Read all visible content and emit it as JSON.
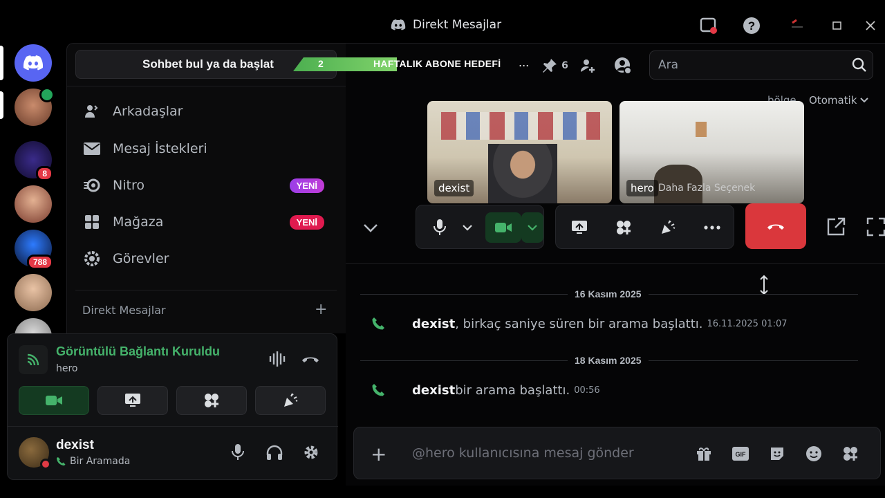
{
  "window": {
    "title": "Direkt Mesajlar"
  },
  "servers": [
    {
      "name": "Discord Home"
    },
    {
      "name": "Server 2"
    },
    {
      "name": "Server 3",
      "badge": "8"
    },
    {
      "name": "Server 4"
    },
    {
      "name": "Server 5",
      "badge": "788"
    },
    {
      "name": "Server 6"
    }
  ],
  "sidebar": {
    "find_label": "Sohbet bul ya da başlat",
    "items": [
      {
        "label": "Arkadaşlar"
      },
      {
        "label": "Mesaj İstekleri"
      },
      {
        "label": "Nitro",
        "badge": "YENİ"
      },
      {
        "label": "Mağaza",
        "badge": "YENİ"
      },
      {
        "label": "Görevler"
      }
    ],
    "dm_header": "Direkt Mesajlar"
  },
  "voice": {
    "status": "Görüntülü Bağlantı Kuruldu",
    "channel": "hero"
  },
  "user": {
    "name": "dexist",
    "status": "Bir Aramada"
  },
  "overlay": {
    "goal_value": "2",
    "goal_label": "HAFTALIK ABONE HEDEFİ",
    "goal_dots": "..."
  },
  "header": {
    "pinned_count": "6",
    "search_placeholder": "Ara",
    "region_label": "bölge",
    "region_value": "Otomatik"
  },
  "video": {
    "tiles": [
      {
        "name": "dexist"
      },
      {
        "name": "hero",
        "hint": "Daha Fazla Seçenek"
      }
    ]
  },
  "chat": {
    "separators": [
      "16 Kasım 2025",
      "18 Kasım 2025"
    ],
    "messages": [
      {
        "who": "dexist",
        "text": ", birkaç saniye süren bir arama başlattı.",
        "time": "16.11.2025 01:07"
      },
      {
        "who": "dexist",
        "text": " bir arama başlattı.",
        "time": "00:56"
      }
    ],
    "composer_placeholder": "@hero kullanıcısına mesaj gönder"
  },
  "colors": {
    "accent": "#5865f2",
    "green": "#45b36b",
    "danger": "#da373c"
  }
}
